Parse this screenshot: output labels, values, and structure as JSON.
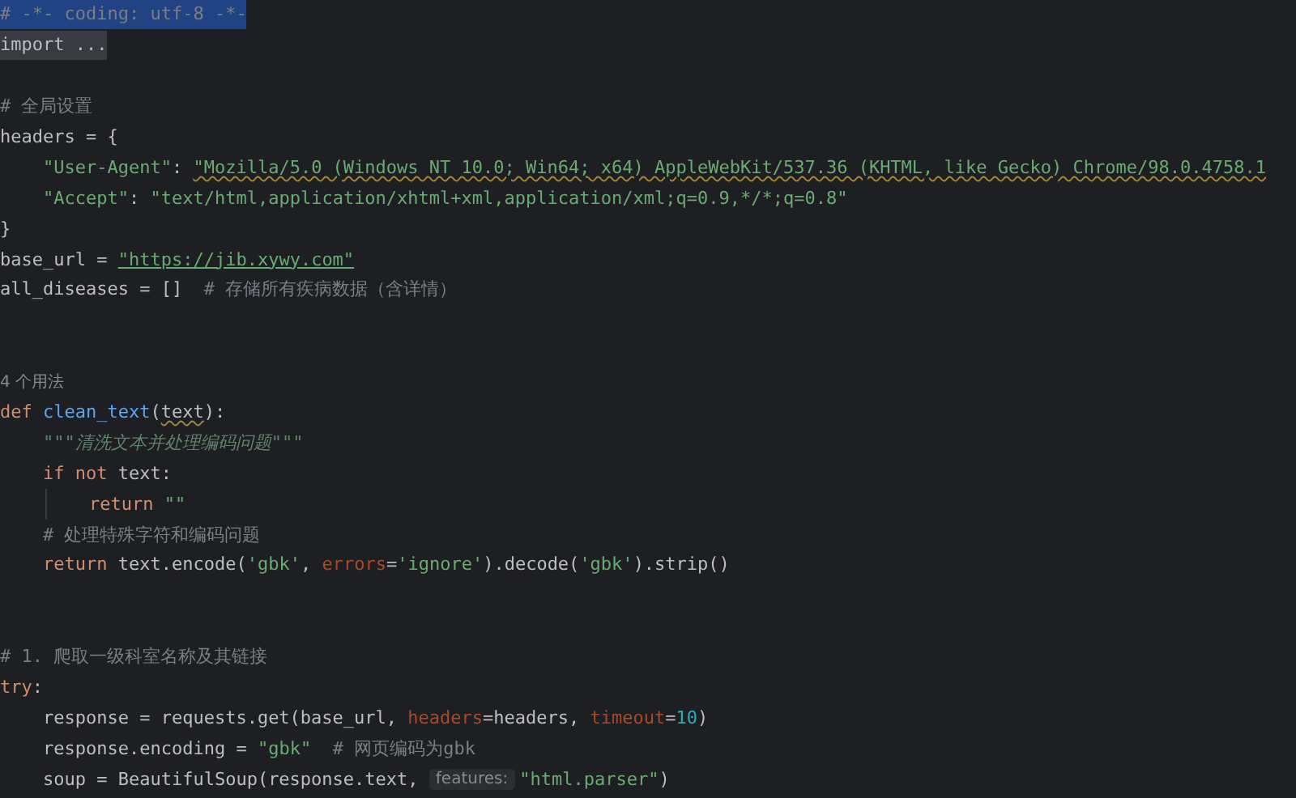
{
  "editor": {
    "lines": [
      {
        "kind": "code",
        "selected": true,
        "tokens": [
          {
            "kind": "comment",
            "text": "# -*- coding: utf-8 -*-"
          }
        ]
      },
      {
        "kind": "code",
        "selected": false,
        "tokens": [
          {
            "kind": "fold",
            "text": "import ..."
          }
        ]
      },
      {
        "kind": "blank"
      },
      {
        "kind": "code",
        "selected": false,
        "tokens": [
          {
            "kind": "comment",
            "text": "# 全局设置"
          }
        ]
      },
      {
        "kind": "code",
        "selected": false,
        "tokens": [
          {
            "kind": "plain",
            "text": "headers = {"
          }
        ]
      },
      {
        "kind": "code",
        "selected": false,
        "tokens": [
          {
            "kind": "string",
            "text": "    \"User-Agent\""
          },
          {
            "kind": "plain",
            "text": ": "
          },
          {
            "kind": "string",
            "text": "\"Mozilla/5.0 (Windows NT 10.0; Win64; x64) AppleWebKit/537.36 (KHTML, like Gecko) Chrome/98.0.4758.1",
            "warning": true
          }
        ]
      },
      {
        "kind": "code",
        "selected": false,
        "tokens": [
          {
            "kind": "string",
            "text": "    \"Accept\""
          },
          {
            "kind": "plain",
            "text": ": "
          },
          {
            "kind": "string",
            "text": "\"text/html,application/xhtml+xml,application/xml;q=0.9,*/*;q=0.8\""
          }
        ]
      },
      {
        "kind": "code",
        "selected": false,
        "tokens": [
          {
            "kind": "plain",
            "text": "}"
          }
        ]
      },
      {
        "kind": "code",
        "selected": false,
        "tokens": [
          {
            "kind": "plain",
            "text": "base_url = "
          },
          {
            "kind": "link",
            "text": "\"https://jib.xywy.com\""
          }
        ]
      },
      {
        "kind": "code",
        "selected": false,
        "tokens": [
          {
            "kind": "plain",
            "text": "all_diseases = []  "
          },
          {
            "kind": "comment",
            "text": "# 存储所有疾病数据（含详情）"
          }
        ]
      },
      {
        "kind": "blank"
      },
      {
        "kind": "blank"
      },
      {
        "kind": "code",
        "selected": false,
        "tokens": [
          {
            "kind": "hint",
            "text": "4 个用法"
          }
        ]
      },
      {
        "kind": "code",
        "selected": false,
        "tokens": [
          {
            "kind": "keyword",
            "text": "def "
          },
          {
            "kind": "func",
            "text": "clean_text"
          },
          {
            "kind": "plain",
            "text": "("
          },
          {
            "kind": "plain",
            "text": "text",
            "warning": true
          },
          {
            "kind": "plain",
            "text": "):"
          }
        ]
      },
      {
        "kind": "code",
        "selected": false,
        "tokens": [
          {
            "kind": "docstring",
            "text": "    \"\"\"清洗文本并处理编码问题\"\"\""
          }
        ]
      },
      {
        "kind": "code",
        "selected": false,
        "tokens": [
          {
            "kind": "keyword",
            "text": "    if not "
          },
          {
            "kind": "plain",
            "text": "text:"
          }
        ]
      },
      {
        "kind": "code",
        "selected": false,
        "indent_guide": true,
        "tokens": [
          {
            "kind": "keyword",
            "text": "return "
          },
          {
            "kind": "string",
            "text": "\"\""
          }
        ]
      },
      {
        "kind": "code",
        "selected": false,
        "tokens": [
          {
            "kind": "comment",
            "text": "    # 处理特殊字符和编码问题"
          }
        ]
      },
      {
        "kind": "code",
        "selected": false,
        "tokens": [
          {
            "kind": "keyword",
            "text": "    return "
          },
          {
            "kind": "plain",
            "text": "text.encode("
          },
          {
            "kind": "string",
            "text": "'gbk'"
          },
          {
            "kind": "plain",
            "text": ", "
          },
          {
            "kind": "arg",
            "text": "errors"
          },
          {
            "kind": "plain",
            "text": "="
          },
          {
            "kind": "string",
            "text": "'ignore'"
          },
          {
            "kind": "plain",
            "text": ").decode("
          },
          {
            "kind": "string",
            "text": "'gbk'"
          },
          {
            "kind": "plain",
            "text": ").strip()"
          }
        ]
      },
      {
        "kind": "blank"
      },
      {
        "kind": "blank"
      },
      {
        "kind": "code",
        "selected": false,
        "tokens": [
          {
            "kind": "comment",
            "text": "# 1. 爬取一级科室名称及其链接"
          }
        ]
      },
      {
        "kind": "code",
        "selected": false,
        "tokens": [
          {
            "kind": "keyword",
            "text": "try"
          },
          {
            "kind": "plain",
            "text": ":"
          }
        ]
      },
      {
        "kind": "code",
        "selected": false,
        "tokens": [
          {
            "kind": "plain",
            "text": "    response = requests.get(base_url, "
          },
          {
            "kind": "arg",
            "text": "headers"
          },
          {
            "kind": "plain",
            "text": "=headers, "
          },
          {
            "kind": "arg",
            "text": "timeout"
          },
          {
            "kind": "plain",
            "text": "="
          },
          {
            "kind": "number",
            "text": "10"
          },
          {
            "kind": "plain",
            "text": ")"
          }
        ]
      },
      {
        "kind": "code",
        "selected": false,
        "tokens": [
          {
            "kind": "plain",
            "text": "    response.encoding = "
          },
          {
            "kind": "string",
            "text": "\"gbk\""
          },
          {
            "kind": "comment",
            "text": "  # 网页编码为gbk"
          }
        ]
      },
      {
        "kind": "code",
        "selected": false,
        "tokens": [
          {
            "kind": "plain",
            "text": "    soup = BeautifulSoup(response.text, "
          },
          {
            "kind": "hint",
            "text": "features:"
          },
          {
            "kind": "string",
            "text": "\"html.parser\""
          },
          {
            "kind": "plain",
            "text": ")"
          }
        ]
      }
    ]
  }
}
